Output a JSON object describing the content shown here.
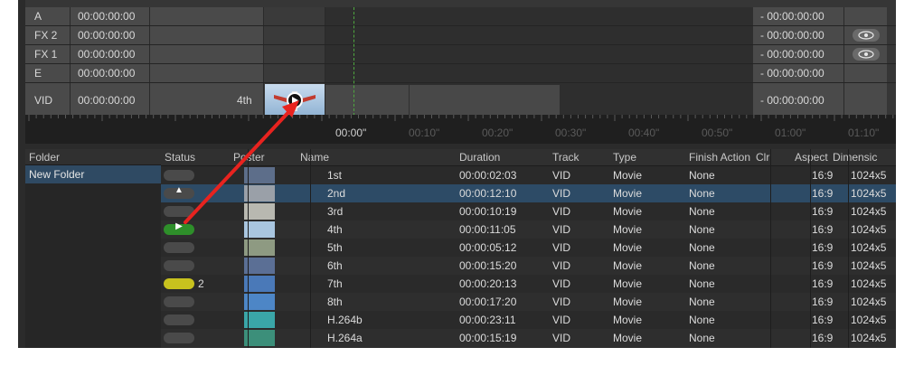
{
  "tracks": [
    {
      "name": "A",
      "start": "00:00:00:00",
      "end": "- 00:00:00:00",
      "eye": false
    },
    {
      "name": "FX 2",
      "start": "00:00:00:00",
      "end": "- 00:00:00:00",
      "eye": true
    },
    {
      "name": "FX 1",
      "start": "00:00:00:00",
      "end": "- 00:00:00:00",
      "eye": true
    },
    {
      "name": "E",
      "start": "00:00:00:00",
      "end": "- 00:00:00:00",
      "eye": false
    },
    {
      "name": "VID",
      "start": "00:00:00:00",
      "end": "- 00:00:00:00",
      "eye": false,
      "clip_label": "4th"
    }
  ],
  "ruler": {
    "labels": [
      "00:00\"",
      "00:10\"",
      "00:20\"",
      "00:30\"",
      "00:40\"",
      "00:50\"",
      "01:00\"",
      "01:10\""
    ],
    "active_index": 0
  },
  "folders": {
    "header": "Folder",
    "items": [
      "New Folder"
    ]
  },
  "columns": {
    "status": "Status",
    "poster": "Poster",
    "name": "Name",
    "duration": "Duration",
    "track": "Track",
    "type": "Type",
    "finish": "Finish Action",
    "clr": "Clr",
    "aspect": "Aspect",
    "dimensions": "Dimensic"
  },
  "cues": [
    {
      "name": "1st",
      "duration": "00:00:02:03",
      "track": "VID",
      "type": "Movie",
      "finish": "None",
      "aspect": "16:9",
      "dims": "1024x5",
      "status": "gray",
      "glyph": "",
      "badge": "",
      "color": "#5d6e8a"
    },
    {
      "name": "2nd",
      "duration": "00:00:12:10",
      "track": "VID",
      "type": "Movie",
      "finish": "None",
      "aspect": "16:9",
      "dims": "1024x5",
      "status": "gray",
      "glyph": "▲",
      "badge": "",
      "color": "#9aa0a8"
    },
    {
      "name": "3rd",
      "duration": "00:00:10:19",
      "track": "VID",
      "type": "Movie",
      "finish": "None",
      "aspect": "16:9",
      "dims": "1024x5",
      "status": "gray",
      "glyph": "",
      "badge": "",
      "color": "#b8b8b0"
    },
    {
      "name": "4th",
      "duration": "00:00:11:05",
      "track": "VID",
      "type": "Movie",
      "finish": "None",
      "aspect": "16:9",
      "dims": "1024x5",
      "status": "green",
      "glyph": "▶",
      "badge": "",
      "color": "#a9c6e0"
    },
    {
      "name": "5th",
      "duration": "00:00:05:12",
      "track": "VID",
      "type": "Movie",
      "finish": "None",
      "aspect": "16:9",
      "dims": "1024x5",
      "status": "gray",
      "glyph": "",
      "badge": "",
      "color": "#8e9a82"
    },
    {
      "name": "6th",
      "duration": "00:00:15:20",
      "track": "VID",
      "type": "Movie",
      "finish": "None",
      "aspect": "16:9",
      "dims": "1024x5",
      "status": "gray",
      "glyph": "",
      "badge": "",
      "color": "#5b6f95"
    },
    {
      "name": "7th",
      "duration": "00:00:20:13",
      "track": "VID",
      "type": "Movie",
      "finish": "None",
      "aspect": "16:9",
      "dims": "1024x5",
      "status": "yellow",
      "glyph": "",
      "badge": "2",
      "color": "#4a79b8"
    },
    {
      "name": "8th",
      "duration": "00:00:17:20",
      "track": "VID",
      "type": "Movie",
      "finish": "None",
      "aspect": "16:9",
      "dims": "1024x5",
      "status": "gray",
      "glyph": "",
      "badge": "",
      "color": "#4d86c6"
    },
    {
      "name": "H.264b",
      "duration": "00:00:23:11",
      "track": "VID",
      "type": "Movie",
      "finish": "None",
      "aspect": "16:9",
      "dims": "1024x5",
      "status": "gray",
      "glyph": "",
      "badge": "",
      "color": "#3aa6a8"
    },
    {
      "name": "H.264a",
      "duration": "00:00:15:19",
      "track": "VID",
      "type": "Movie",
      "finish": "None",
      "aspect": "16:9",
      "dims": "1024x5",
      "status": "gray",
      "glyph": "",
      "badge": "",
      "color": "#3c8f7a"
    }
  ],
  "selected_row": 1,
  "colors": {
    "accent_selection": "#2d4b66",
    "playhead": "#4fa83f",
    "annotation_arrow": "#e8231f",
    "status_playing": "#2e8f2a",
    "status_loaded": "#c8c21e"
  }
}
